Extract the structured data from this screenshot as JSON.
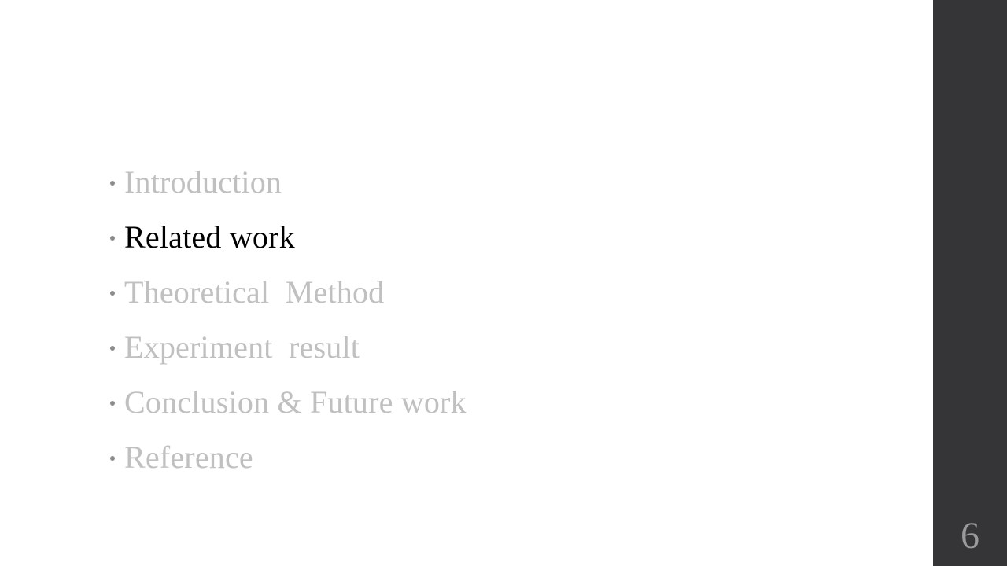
{
  "agenda": {
    "items": [
      {
        "label": "Introduction",
        "active": false
      },
      {
        "label": "Related work",
        "active": true
      },
      {
        "label": "Theoretical  Method",
        "active": false
      },
      {
        "label": "Experiment  result",
        "active": false
      },
      {
        "label": "Conclusion & Future work",
        "active": false
      },
      {
        "label": "Reference",
        "active": false
      }
    ]
  },
  "slide": {
    "page_number": "6"
  },
  "colors": {
    "active_text": "#000000",
    "inactive_text": "#c0c0c0",
    "sidebar": "#353537",
    "page_number": "#9a9a9a",
    "bullet": "#8c8c8c"
  }
}
